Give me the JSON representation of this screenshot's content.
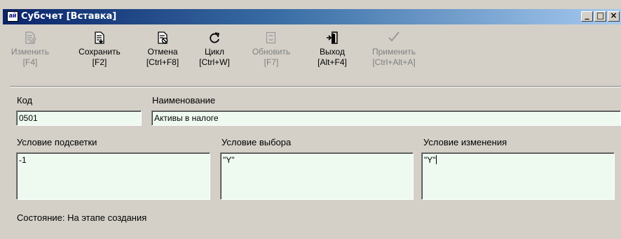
{
  "window": {
    "icon_text": "ай",
    "title": "Субсчет [Вставка]",
    "controls": {
      "minimize": "_",
      "maximize": "□",
      "close": "×"
    }
  },
  "toolbar": [
    {
      "id": "edit",
      "label": "Изменить",
      "shortcut": "[F4]",
      "icon": "edit-document-icon",
      "enabled": false
    },
    {
      "id": "save",
      "label": "Сохранить",
      "shortcut": "[F2]",
      "icon": "save-document-icon",
      "enabled": true
    },
    {
      "id": "cancel",
      "label": "Отмена",
      "shortcut": "[Ctrl+F8]",
      "icon": "cancel-document-icon",
      "enabled": true
    },
    {
      "id": "loop",
      "label": "Цикл",
      "shortcut": "[Ctrl+W]",
      "icon": "loop-icon",
      "enabled": true
    },
    {
      "id": "refresh",
      "label": "Обновить",
      "shortcut": "[F7]",
      "icon": "refresh-icon",
      "enabled": false
    },
    {
      "id": "exit",
      "label": "Выход",
      "shortcut": "[Alt+F4]",
      "icon": "exit-door-icon",
      "enabled": true
    },
    {
      "id": "apply",
      "label": "Применить",
      "shortcut": "[Ctrl+Alt+A]",
      "icon": "checkmark-icon",
      "enabled": false
    }
  ],
  "form": {
    "code_label": "Код",
    "code_value": "0501",
    "name_label": "Наименование",
    "name_value": "Активы в налоге",
    "highlight_label": "Условие подсветки",
    "highlight_value": "-1",
    "select_label": "Условие выбора",
    "select_value": "\"Y\"",
    "change_label": "Условие изменения",
    "change_value": "\"Y\""
  },
  "status": "Состояние: На этапе создания"
}
